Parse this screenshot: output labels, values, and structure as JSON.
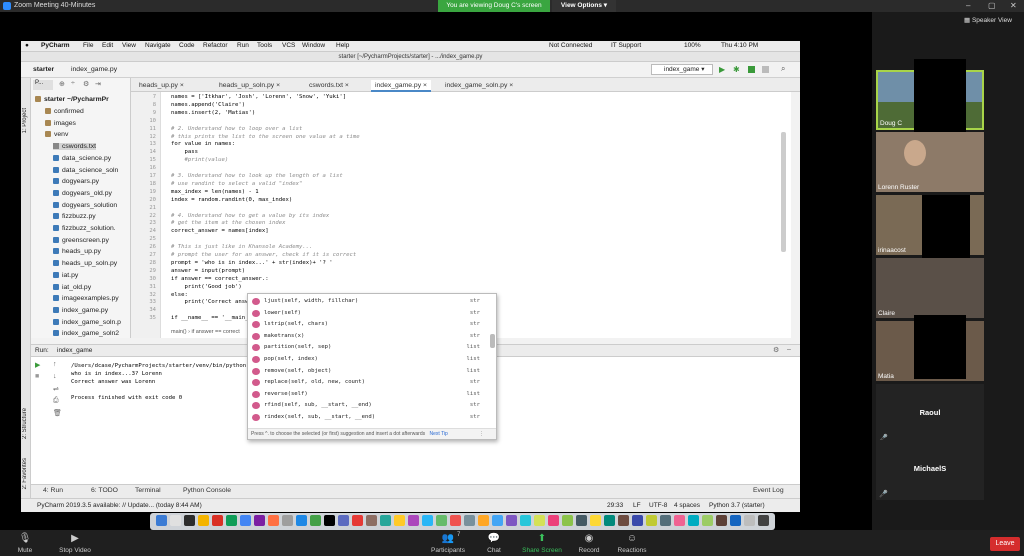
{
  "zoom": {
    "title": "Zoom Meeting 40-Minutes",
    "viewing_banner": "You are viewing Doug C's screen",
    "view_options": "View Options",
    "speaker_view": "Speaker View",
    "bottom": {
      "mute": "Mute",
      "stop_video": "Stop Video",
      "participants": "Participants",
      "participants_count": "7",
      "chat": "Chat",
      "share_screen": "Share Screen",
      "record": "Record",
      "reactions": "Reactions",
      "leave": "Leave"
    }
  },
  "macbar": {
    "app": "PyCharm",
    "menus": [
      "File",
      "Edit",
      "View",
      "Navigate",
      "Code",
      "Refactor",
      "Run",
      "Tools",
      "VCS",
      "Window",
      "Help"
    ],
    "not_connected": "Not Connected",
    "it_support": "IT Support",
    "battery": "100%",
    "clock": "Thu 4:10 PM"
  },
  "pycharm": {
    "title": "starter [~/PycharmProjects/starter] - .../index_game.py",
    "breadcrumb_project": "starter",
    "breadcrumb_file": "index_game.py",
    "run_config": "index_game",
    "tabs": [
      "heads_up.py",
      "heads_up_soln.py",
      "cswords.txt",
      "index_game.py",
      "index_game_soln.py"
    ],
    "active_tab": "index_game.py",
    "project_root": "starter ~/PycharmPr",
    "project_dropdown": "P...",
    "tree": [
      {
        "name": "confirmed",
        "kind": "folder"
      },
      {
        "name": "images",
        "kind": "folder"
      },
      {
        "name": "venv",
        "kind": "folder"
      },
      {
        "name": "cswords.txt",
        "kind": "txt"
      },
      {
        "name": "data_science.py",
        "kind": "py"
      },
      {
        "name": "data_science_soln",
        "kind": "py"
      },
      {
        "name": "dogyears.py",
        "kind": "py"
      },
      {
        "name": "dogyears_old.py",
        "kind": "py"
      },
      {
        "name": "dogyears_solution",
        "kind": "py"
      },
      {
        "name": "fizzbuzz.py",
        "kind": "py"
      },
      {
        "name": "fizzbuzz_solution.",
        "kind": "py"
      },
      {
        "name": "greenscreen.py",
        "kind": "py"
      },
      {
        "name": "heads_up.py",
        "kind": "py"
      },
      {
        "name": "heads_up_soln.py",
        "kind": "py"
      },
      {
        "name": "iat.py",
        "kind": "py"
      },
      {
        "name": "iat_old.py",
        "kind": "py"
      },
      {
        "name": "imageexamples.py",
        "kind": "py"
      },
      {
        "name": "index_game.py",
        "kind": "py"
      },
      {
        "name": "index_game_soln.p",
        "kind": "py"
      },
      {
        "name": "index_game_soln2",
        "kind": "py"
      }
    ],
    "code_lines": [
      {
        "n": "7",
        "t": "names = ['Itkhar', 'Josh', 'Lorenn', 'Snow', 'Yuki']"
      },
      {
        "n": "8",
        "t": "names.append('Claire')"
      },
      {
        "n": "9",
        "t": "names.insert(2, 'Matias')"
      },
      {
        "n": "10",
        "t": ""
      },
      {
        "n": "11",
        "t": "# 2. Understand how to loop over a list"
      },
      {
        "n": "12",
        "t": "# this prints the list to the screen one value at a time"
      },
      {
        "n": "13",
        "t": "for value in names:"
      },
      {
        "n": "14",
        "t": "    pass"
      },
      {
        "n": "15",
        "t": "    #print(value)"
      },
      {
        "n": "16",
        "t": ""
      },
      {
        "n": "17",
        "t": "# 3. Understand how to look up the length of a list"
      },
      {
        "n": "18",
        "t": "# use randint to select a valid \"index\""
      },
      {
        "n": "19",
        "t": "max_index = len(names) - 1"
      },
      {
        "n": "20",
        "t": "index = random.randint(0, max_index)"
      },
      {
        "n": "21",
        "t": ""
      },
      {
        "n": "22",
        "t": "# 4. Understand how to get a value by its index"
      },
      {
        "n": "23",
        "t": "# get the item at the chosen index"
      },
      {
        "n": "24",
        "t": "correct_answer = names[index]"
      },
      {
        "n": "25",
        "t": ""
      },
      {
        "n": "26",
        "t": "# This is just like in Khansole Academy..."
      },
      {
        "n": "27",
        "t": "# prompt the user for an answer, check if it is correct"
      },
      {
        "n": "28",
        "t": "prompt = 'who is in index...' + str(index)+ '? '"
      },
      {
        "n": "29",
        "t": "answer = input(prompt)"
      },
      {
        "n": "30",
        "t": "if answer == correct_answer.:"
      },
      {
        "n": "31",
        "t": "    print('Good job')"
      },
      {
        "n": "32",
        "t": "else:"
      },
      {
        "n": "33",
        "t": "    print('Correct answ"
      },
      {
        "n": "34",
        "t": ""
      },
      {
        "n": "35",
        "t": "if __name__ == '__main__':"
      }
    ],
    "breadcrumb_bottom": "main()  ›  if answer == correct",
    "autocomplete": [
      {
        "name": "ljust(self, width, fillchar)",
        "type": "str"
      },
      {
        "name": "lower(self)",
        "type": "str"
      },
      {
        "name": "lstrip(self, chars)",
        "type": "str"
      },
      {
        "name": "maketrans(x)",
        "type": "str"
      },
      {
        "name": "partition(self, sep)",
        "type": "list"
      },
      {
        "name": "pop(self, index)",
        "type": "list"
      },
      {
        "name": "remove(self, object)",
        "type": "list"
      },
      {
        "name": "replace(self, old, new, count)",
        "type": "str"
      },
      {
        "name": "reverse(self)",
        "type": "list"
      },
      {
        "name": "rfind(self, sub, __start, __end)",
        "type": "str"
      },
      {
        "name": "rindex(self, sub, __start, __end)",
        "type": "str"
      }
    ],
    "ac_footer": "Press ^. to choose the selected (or first) suggestion and insert a dot afterwards",
    "ac_next_tip": "Next Tip",
    "run": {
      "label": "Run:",
      "config": "index_game",
      "output": [
        "/Users/dcase/PycharmProjects/starter/venv/bin/python /",
        "who is in index...3? Lorenn",
        "Correct answer was Lorenn",
        "",
        "Process finished with exit code 0"
      ]
    },
    "bottom_tabs": [
      "4: Run",
      "6: TODO",
      "Terminal",
      "Python Console"
    ],
    "event_log": "Event Log",
    "side_structure": "2: Structure",
    "side_favorites": "2: Favorites",
    "side_project": "1: Project",
    "status": {
      "message": "PyCharm 2019.3.5 available: // Update... (today 8:44 AM)",
      "position": "29:33",
      "line_sep": "LF",
      "encoding": "UTF-8",
      "indent": "4 spaces",
      "interpreter": "Python 3.7 (starter)"
    }
  },
  "participants": [
    {
      "name": "Doug C"
    },
    {
      "name": "Lorenn Ruster"
    },
    {
      "name": "irinaacost"
    },
    {
      "name": "Claire"
    },
    {
      "name": "Matia"
    },
    {
      "name": "Raoul"
    },
    {
      "name": "MichaelS"
    }
  ]
}
